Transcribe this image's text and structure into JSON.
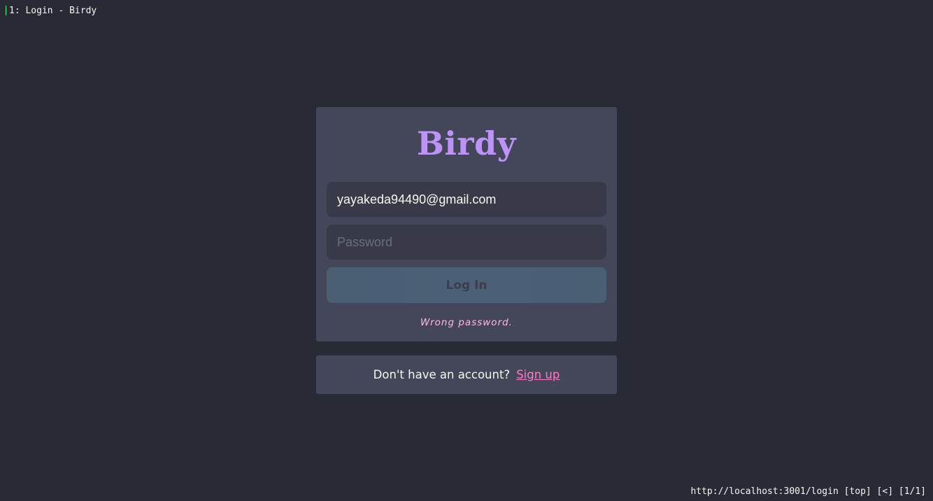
{
  "browser": {
    "tab_label": "1: Login - Birdy",
    "status_url": "http://localhost:3001/login [top] [<] [1/1]"
  },
  "login": {
    "brand": "Birdy",
    "email_value": "yayakeda94490@gmail.com",
    "password_placeholder": "Password",
    "button_label": "Log In",
    "error_message": "Wrong password."
  },
  "signup": {
    "prompt": "Don't have an account?",
    "link_label": "Sign up"
  },
  "colors": {
    "background": "#282a36",
    "card": "#44475a",
    "brand": "#bd93f9",
    "link": "#ff79c6",
    "error": "#ffb8e0"
  }
}
